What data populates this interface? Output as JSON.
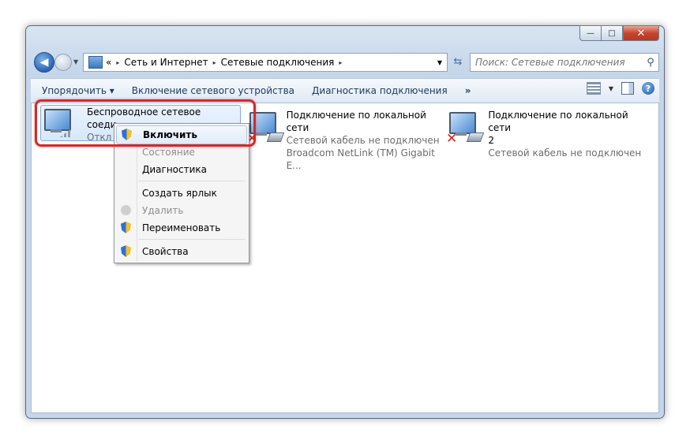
{
  "window": {
    "caption": {
      "minimize": "—",
      "maximize": "□",
      "close": "✕"
    }
  },
  "address": {
    "crumb_start": "«",
    "crumbs": [
      "Сеть и Интернет",
      "Сетевые подключения"
    ],
    "separator": "▸",
    "search_placeholder": "Поиск: Сетевые подключения"
  },
  "toolbar": {
    "organize": "Упорядочить ▾",
    "enable_device": "Включение сетевого устройства",
    "diagnose": "Диагностика подключения",
    "more": "»",
    "help": "?"
  },
  "items": [
    {
      "name": "Беспроводное сетевое",
      "name2": "соеди",
      "sub": "Откл"
    },
    {
      "name": "Подключение по локальной сети",
      "sub": "Сетевой кабель не подключен",
      "sub2": "Broadcom NetLink (TM) Gigabit E..."
    },
    {
      "name": "Подключение по локальной сети",
      "name2": "2",
      "sub": "Сетевой кабель не подключен"
    }
  ],
  "menu": {
    "enable": "Включить",
    "status": "Состояние",
    "diagnostics": "Диагностика",
    "shortcut": "Создать ярлык",
    "delete": "Удалить",
    "rename": "Переименовать",
    "properties": "Свойства"
  },
  "colors": {
    "highlight_frame": "#d5292a",
    "close_button": "#c8442d"
  }
}
